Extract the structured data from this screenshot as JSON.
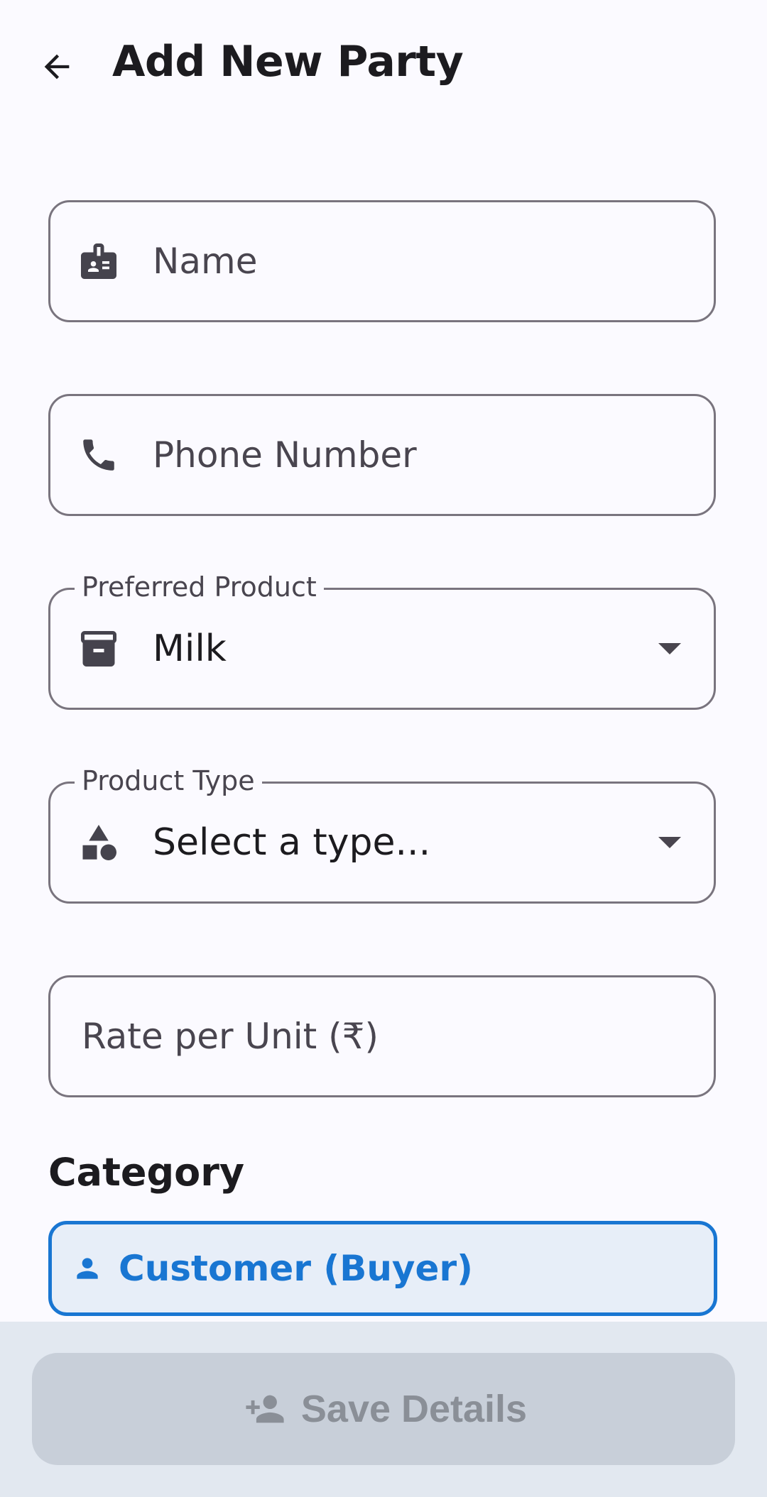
{
  "app_bar": {
    "title": "Add New Party",
    "back_icon": "arrow-back-icon"
  },
  "form": {
    "name": {
      "placeholder": "Name",
      "icon": "badge-icon"
    },
    "phone": {
      "placeholder": "Phone Number",
      "icon": "phone-icon"
    },
    "preferred_product": {
      "label": "Preferred Product",
      "value": "Milk",
      "icon": "archive-box-icon"
    },
    "product_type": {
      "label": "Product Type",
      "value": "Select a type...",
      "icon": "category-shapes-icon"
    },
    "rate": {
      "placeholder": "Rate per Unit (₹)"
    }
  },
  "category": {
    "heading": "Category",
    "selected": {
      "label": "Customer (Buyer)",
      "icon": "person-icon"
    }
  },
  "footer": {
    "save_label": "Save Details",
    "save_icon": "person-add-icon"
  },
  "colors": {
    "accent": "#1976d2",
    "background": "#fbfaff",
    "outline": "#79747e",
    "disabled_button": "#c8cfd9",
    "bottom_bar": "#e2e8f0"
  }
}
